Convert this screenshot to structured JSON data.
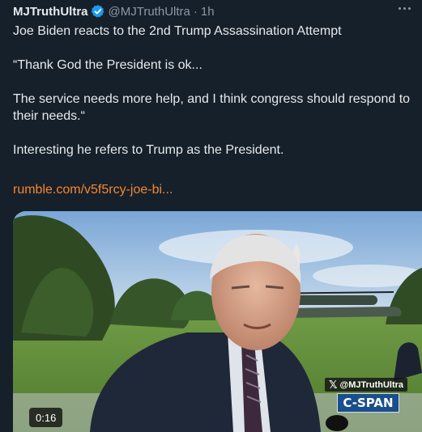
{
  "tweet": {
    "author_name": "MJTruthUltra",
    "author_handle": "@MJTruthUltra",
    "separator": "·",
    "timestamp": "1h",
    "lines": [
      "Joe Biden reacts to the 2nd Trump Assassination Attempt",
      "“Thank God the President is ok...",
      "The service needs more help, and I think congress should respond to their needs.“",
      "Interesting he refers to Trump as the President."
    ],
    "link_text": "rumble.com/v5f5rcy-joe-bi..."
  },
  "media": {
    "watermark_text": "@MJTruthUltra",
    "channel_logo": "C-SPAN",
    "duration": "0:16"
  },
  "colors": {
    "background": "#15202b",
    "text": "#e7e9ea",
    "secondary": "#8b98a5",
    "link": "#f7862f",
    "verified": "#1d9bf0"
  },
  "icons": [
    "verified-badge-icon",
    "more-options-icon",
    "x-logo-icon"
  ]
}
